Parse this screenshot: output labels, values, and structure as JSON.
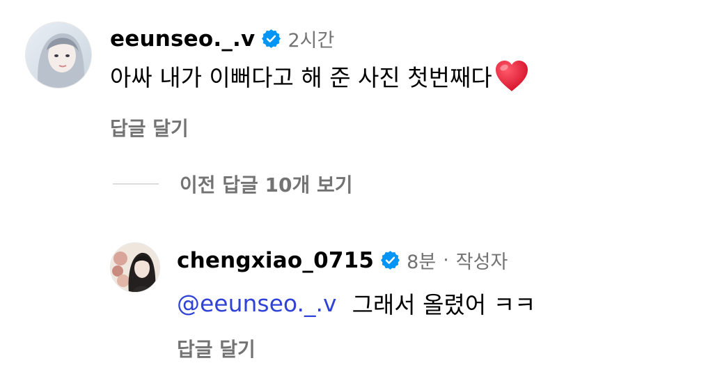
{
  "comment": {
    "username": "eeunseo._.v",
    "time": "2시간",
    "text": "아싸 내가 이뻐다고 해 준 사진 첫번째다",
    "reply_label": "답글 달기",
    "icons": {
      "verified": "verified-badge-icon",
      "emoji": "red-heart-emoji"
    }
  },
  "view_replies": {
    "label": "이전 답글 10개 보기"
  },
  "reply": {
    "username": "chengxiao_0715",
    "time": "8분",
    "separator": "·",
    "author_tag": "작성자",
    "mention": "@eeunseo._.v",
    "text": "그래서 올렸어 ㅋㅋ",
    "reply_label": "답글 달기",
    "icons": {
      "verified": "verified-badge-icon"
    }
  },
  "colors": {
    "text_primary": "#000000",
    "text_secondary": "#737373",
    "mention": "#3143d6",
    "verified": "#0095f6",
    "heart": "#e8112d"
  }
}
